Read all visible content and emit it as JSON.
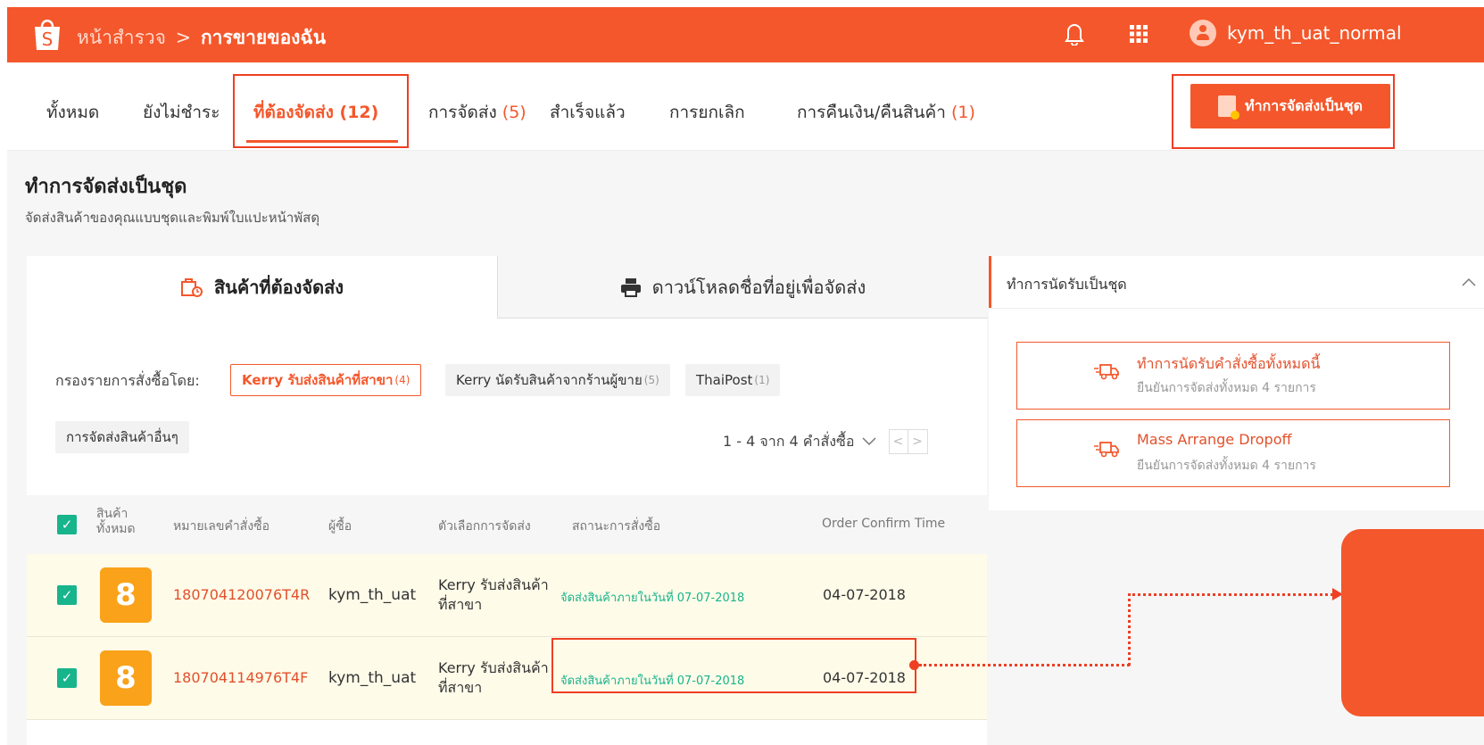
{
  "header": {
    "breadcrumb_home": "หน้าสำรวจ",
    "breadcrumb_sep": ">",
    "breadcrumb_current": "การขายของฉัน",
    "username": "kym_th_uat_normal",
    "icons": [
      "shopee-bag-icon",
      "bell-icon",
      "apps-grid-icon",
      "user-avatar-icon"
    ]
  },
  "tabs": [
    {
      "label": "ทั้งหมด",
      "count": ""
    },
    {
      "label": "ยังไม่ชำระ",
      "count": ""
    },
    {
      "label": "ที่ต้องจัดส่ง",
      "count": "(12)"
    },
    {
      "label": "การจัดส่ง",
      "count": "(5)"
    },
    {
      "label": "สำเร็จแล้ว",
      "count": ""
    },
    {
      "label": "การยกเลิก",
      "count": ""
    },
    {
      "label": "การคืนเงิน/คืนสินค้า",
      "count": "(1)"
    }
  ],
  "mass_ship_button": "ทำการจัดส่งเป็นชุด",
  "page": {
    "title": "ทำการจัดส่งเป็นชุด",
    "subtitle": "จัดส่งสินค้าของคุณแบบชุดและพิมพ์ใบแปะหน้าพัสดุ"
  },
  "card_tabs": {
    "to_ship": "สินค้าที่ต้องจัดส่ง",
    "download": "ดาวน์โหลดชื่อที่อยู่เพื่อจัดส่ง"
  },
  "filter": {
    "label": "กรองรายการสั่งซื้อโดย:",
    "chips": [
      {
        "label": "Kerry รับส่งสินค้าที่สาขา",
        "count": "(4)"
      },
      {
        "label": "Kerry นัดรับสินค้าจากร้านผู้ขาย",
        "count": "(5)"
      },
      {
        "label": "ThaiPost",
        "count": "(1)"
      },
      {
        "label": "การจัดส่งสินค้าอื่นๆ",
        "count": ""
      }
    ]
  },
  "pager": {
    "text": "1 - 4 จาก 4 คำสั่งซื้อ",
    "prev": "<",
    "next": ">"
  },
  "table": {
    "headers": {
      "all_products_line1": "สินค้า",
      "all_products_line2": "ทั้งหมด",
      "order_no": "หมายเลขคำสั่งซื้อ",
      "buyer": "ผู้ซื้อ",
      "shipping_option": "ตัวเลือกการจัดส่ง",
      "order_status": "สถานะการสั่งซื้อ",
      "confirm_time": "Order Confirm Time"
    },
    "rows": [
      {
        "qty": "8",
        "order_id": "180704120076T4R",
        "buyer": "kym_th_uat",
        "ship_line1": "Kerry รับส่งสินค้า",
        "ship_line2": "ที่สาขา",
        "status": "จัดส่งสินค้าภายในวันที่ 07-07-2018",
        "confirm_time": "04-07-2018"
      },
      {
        "qty": "8",
        "order_id": "180704114976T4F",
        "buyer": "kym_th_uat",
        "ship_line1": "Kerry รับส่งสินค้า",
        "ship_line2": "ที่สาขา",
        "status": "จัดส่งสินค้าภายในวันที่ 07-07-2018",
        "confirm_time": "04-07-2018"
      }
    ]
  },
  "side_panel": {
    "title": "ทำการนัดรับเป็นชุด",
    "options": [
      {
        "title": "ทำการนัดรับคำสั่งซื้อทั้งหมดนี้",
        "sub": "ยืนยันการจัดส่งทั้งหมด 4 รายการ"
      },
      {
        "title": "Mass Arrange Dropoff",
        "sub": "ยืนยันการจัดส่งทั้งหมด 4 รายการ"
      }
    ]
  },
  "colors": {
    "brand": "#f4572b",
    "status_green": "#18b48c",
    "annotation_red": "#ee3f22",
    "row_highlight": "#fffbe9"
  }
}
